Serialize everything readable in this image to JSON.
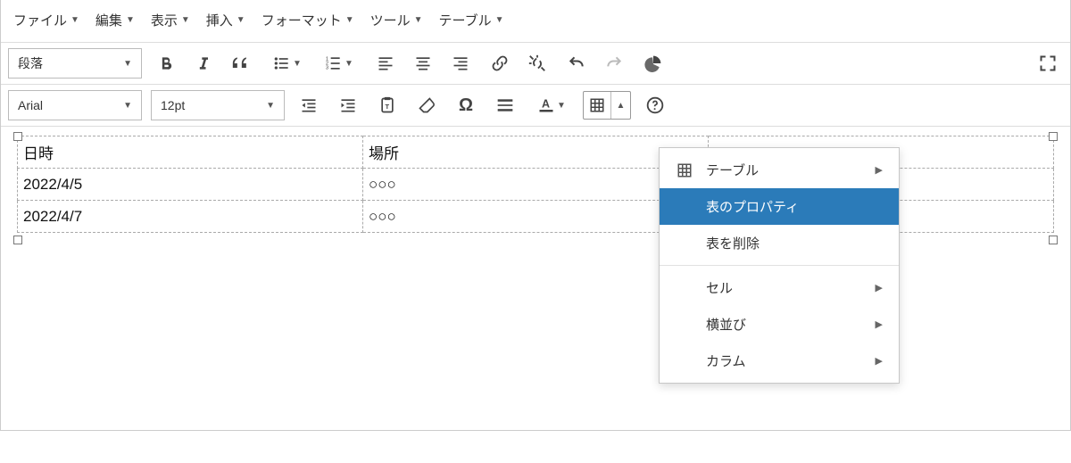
{
  "menubar": {
    "file": "ファイル",
    "edit": "編集",
    "view": "表示",
    "insert": "挿入",
    "format": "フォーマット",
    "tools": "ツール",
    "table": "テーブル"
  },
  "toolbar1": {
    "format_select": "段落"
  },
  "toolbar2": {
    "font_select": "Arial",
    "size_select": "12pt"
  },
  "table": {
    "headers": [
      "日時",
      "場所"
    ],
    "rows": [
      [
        "2022/4/5",
        "○○○"
      ],
      [
        "2022/4/7",
        "○○○"
      ]
    ]
  },
  "dropdown": {
    "table_submenu": "テーブル",
    "table_properties": "表のプロパティ",
    "delete_table": "表を削除",
    "cell": "セル",
    "row": "横並び",
    "column": "カラム"
  }
}
